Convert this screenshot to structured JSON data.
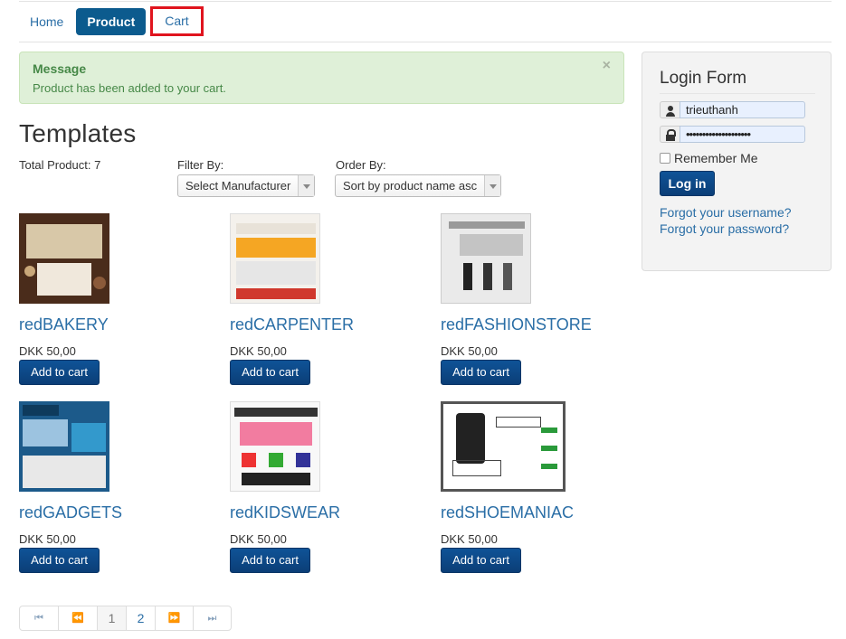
{
  "nav": {
    "items": [
      {
        "label": "Home"
      },
      {
        "label": "Product"
      },
      {
        "label": "Cart"
      }
    ]
  },
  "alert": {
    "title": "Message",
    "text": "Product has been added to your cart.",
    "close": "×"
  },
  "page": {
    "title": "Templates",
    "total_label": "Total Product: 7"
  },
  "filters": {
    "filter_label": "Filter By:",
    "filter_value": "Select Manufacturer",
    "order_label": "Order By:",
    "order_value": "Sort by product name asc"
  },
  "products": [
    {
      "name": "redBAKERY",
      "price": "DKK 50,00",
      "button": "Add to cart"
    },
    {
      "name": "redCARPENTER",
      "price": "DKK 50,00",
      "button": "Add to cart"
    },
    {
      "name": "redFASHIONSTORE",
      "price": "DKK 50,00",
      "button": "Add to cart"
    },
    {
      "name": "redGADGETS",
      "price": "DKK 50,00",
      "button": "Add to cart"
    },
    {
      "name": "redKIDSWEAR",
      "price": "DKK 50,00",
      "button": "Add to cart"
    },
    {
      "name": "redSHOEMANIAC",
      "price": "DKK 50,00",
      "button": "Add to cart"
    }
  ],
  "pagination": {
    "first": "⏮",
    "prev": "⏪",
    "pages": [
      "1",
      "2"
    ],
    "next": "⏩",
    "last": "⏭",
    "current_page": "1"
  },
  "login": {
    "title": "Login Form",
    "username": "trieuthanh",
    "password": "••••••••••••••••••••",
    "remember": "Remember Me",
    "button": "Log in",
    "forgot_username": "Forgot your username?",
    "forgot_password": "Forgot your password?"
  },
  "colors": {
    "accent": "#0c5b8e",
    "link": "#2a6ea6",
    "alert_bg": "#dff0d8",
    "highlight": "#e0141e"
  }
}
